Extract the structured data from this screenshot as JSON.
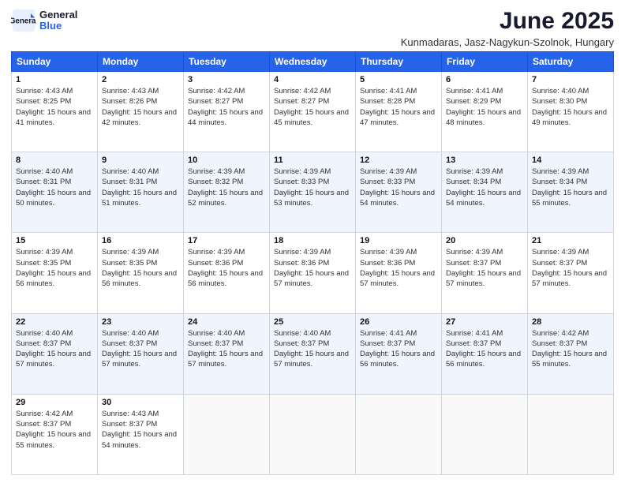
{
  "header": {
    "logo_general": "General",
    "logo_blue": "Blue",
    "title": "June 2025",
    "subtitle": "Kunmadaras, Jasz-Nagykun-Szolnok, Hungary"
  },
  "days_of_week": [
    "Sunday",
    "Monday",
    "Tuesday",
    "Wednesday",
    "Thursday",
    "Friday",
    "Saturday"
  ],
  "weeks": [
    [
      {
        "day": "1",
        "sunrise": "4:43 AM",
        "sunset": "8:25 PM",
        "daylight": "15 hours and 41 minutes."
      },
      {
        "day": "2",
        "sunrise": "4:43 AM",
        "sunset": "8:26 PM",
        "daylight": "15 hours and 42 minutes."
      },
      {
        "day": "3",
        "sunrise": "4:42 AM",
        "sunset": "8:27 PM",
        "daylight": "15 hours and 44 minutes."
      },
      {
        "day": "4",
        "sunrise": "4:42 AM",
        "sunset": "8:27 PM",
        "daylight": "15 hours and 45 minutes."
      },
      {
        "day": "5",
        "sunrise": "4:41 AM",
        "sunset": "8:28 PM",
        "daylight": "15 hours and 47 minutes."
      },
      {
        "day": "6",
        "sunrise": "4:41 AM",
        "sunset": "8:29 PM",
        "daylight": "15 hours and 48 minutes."
      },
      {
        "day": "7",
        "sunrise": "4:40 AM",
        "sunset": "8:30 PM",
        "daylight": "15 hours and 49 minutes."
      }
    ],
    [
      {
        "day": "8",
        "sunrise": "4:40 AM",
        "sunset": "8:31 PM",
        "daylight": "15 hours and 50 minutes."
      },
      {
        "day": "9",
        "sunrise": "4:40 AM",
        "sunset": "8:31 PM",
        "daylight": "15 hours and 51 minutes."
      },
      {
        "day": "10",
        "sunrise": "4:39 AM",
        "sunset": "8:32 PM",
        "daylight": "15 hours and 52 minutes."
      },
      {
        "day": "11",
        "sunrise": "4:39 AM",
        "sunset": "8:33 PM",
        "daylight": "15 hours and 53 minutes."
      },
      {
        "day": "12",
        "sunrise": "4:39 AM",
        "sunset": "8:33 PM",
        "daylight": "15 hours and 54 minutes."
      },
      {
        "day": "13",
        "sunrise": "4:39 AM",
        "sunset": "8:34 PM",
        "daylight": "15 hours and 54 minutes."
      },
      {
        "day": "14",
        "sunrise": "4:39 AM",
        "sunset": "8:34 PM",
        "daylight": "15 hours and 55 minutes."
      }
    ],
    [
      {
        "day": "15",
        "sunrise": "4:39 AM",
        "sunset": "8:35 PM",
        "daylight": "15 hours and 56 minutes."
      },
      {
        "day": "16",
        "sunrise": "4:39 AM",
        "sunset": "8:35 PM",
        "daylight": "15 hours and 56 minutes."
      },
      {
        "day": "17",
        "sunrise": "4:39 AM",
        "sunset": "8:36 PM",
        "daylight": "15 hours and 56 minutes."
      },
      {
        "day": "18",
        "sunrise": "4:39 AM",
        "sunset": "8:36 PM",
        "daylight": "15 hours and 57 minutes."
      },
      {
        "day": "19",
        "sunrise": "4:39 AM",
        "sunset": "8:36 PM",
        "daylight": "15 hours and 57 minutes."
      },
      {
        "day": "20",
        "sunrise": "4:39 AM",
        "sunset": "8:37 PM",
        "daylight": "15 hours and 57 minutes."
      },
      {
        "day": "21",
        "sunrise": "4:39 AM",
        "sunset": "8:37 PM",
        "daylight": "15 hours and 57 minutes."
      }
    ],
    [
      {
        "day": "22",
        "sunrise": "4:40 AM",
        "sunset": "8:37 PM",
        "daylight": "15 hours and 57 minutes."
      },
      {
        "day": "23",
        "sunrise": "4:40 AM",
        "sunset": "8:37 PM",
        "daylight": "15 hours and 57 minutes."
      },
      {
        "day": "24",
        "sunrise": "4:40 AM",
        "sunset": "8:37 PM",
        "daylight": "15 hours and 57 minutes."
      },
      {
        "day": "25",
        "sunrise": "4:40 AM",
        "sunset": "8:37 PM",
        "daylight": "15 hours and 57 minutes."
      },
      {
        "day": "26",
        "sunrise": "4:41 AM",
        "sunset": "8:37 PM",
        "daylight": "15 hours and 56 minutes."
      },
      {
        "day": "27",
        "sunrise": "4:41 AM",
        "sunset": "8:37 PM",
        "daylight": "15 hours and 56 minutes."
      },
      {
        "day": "28",
        "sunrise": "4:42 AM",
        "sunset": "8:37 PM",
        "daylight": "15 hours and 55 minutes."
      }
    ],
    [
      {
        "day": "29",
        "sunrise": "4:42 AM",
        "sunset": "8:37 PM",
        "daylight": "15 hours and 55 minutes."
      },
      {
        "day": "30",
        "sunrise": "4:43 AM",
        "sunset": "8:37 PM",
        "daylight": "15 hours and 54 minutes."
      },
      null,
      null,
      null,
      null,
      null
    ]
  ]
}
